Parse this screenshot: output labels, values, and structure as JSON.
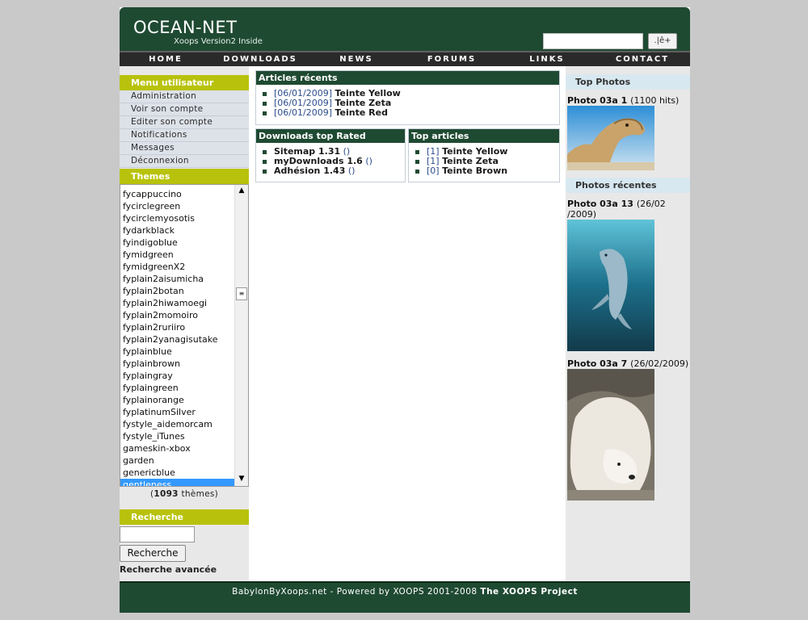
{
  "header": {
    "logo_title": "OCEAN-NET",
    "logo_subtitle": "Xoops Version2 Inside",
    "search_button_label": ".|ê+"
  },
  "nav": [
    "HOME",
    "DOWNLOADS",
    "NEWS",
    "FORUMS",
    "LINKS",
    "CONTACT"
  ],
  "user_menu": {
    "title": "Menu utilisateur",
    "items": [
      "Administration",
      "Voir son compte",
      "Editer son compte",
      "Notifications",
      "Messages",
      "Déconnexion"
    ]
  },
  "themes": {
    "title": "Themes",
    "items": [
      "fycappuccino",
      "fycirclegreen",
      "fycirclemyosotis",
      "fydarkblack",
      "fyindigoblue",
      "fymidgreen",
      "fymidgreenX2",
      "fyplain2aisumicha",
      "fyplain2botan",
      "fyplain2hiwamoegi",
      "fyplain2momoiro",
      "fyplain2ruriiro",
      "fyplain2yanagisutake",
      "fyplainblue",
      "fyplainbrown",
      "fyplaingray",
      "fyplaingreen",
      "fyplainorange",
      "fyplatinumSilver",
      "fystyle_aidemorcam",
      "fystyle_iTunes",
      "gameskin-xbox",
      "garden",
      "genericblue",
      "gentleness"
    ],
    "selected": "gentleness",
    "count": "1093",
    "count_suffix": "thèmes"
  },
  "search_block": {
    "title": "Recherche",
    "button": "Recherche",
    "advanced": "Recherche avancée"
  },
  "recent_articles": {
    "title": "Articles récents",
    "items": [
      {
        "date": "[06/01/2009]",
        "name": "Teinte Yellow"
      },
      {
        "date": "[06/01/2009]",
        "name": "Teinte Zeta"
      },
      {
        "date": "[06/01/2009]",
        "name": "Teinte Red"
      }
    ]
  },
  "downloads_top": {
    "title": "Downloads top Rated",
    "items": [
      {
        "name": "Sitemap 1.31",
        "extra": "()"
      },
      {
        "name": "myDownloads 1.6",
        "extra": "()"
      },
      {
        "name": "Adhésion 1.43",
        "extra": "()"
      }
    ]
  },
  "top_articles": {
    "title": "Top articles",
    "items": [
      {
        "rank": "[1]",
        "name": "Teinte Yellow"
      },
      {
        "rank": "[1]",
        "name": "Teinte Zeta"
      },
      {
        "rank": "[0]",
        "name": "Teinte Brown"
      }
    ]
  },
  "top_photos": {
    "title": "Top Photos",
    "caption": "Photo 03a 1",
    "hits": "(1100 hits)",
    "image": "camel"
  },
  "recent_photos": {
    "title": "Photos récentes",
    "items": [
      {
        "caption": "Photo 03a 13",
        "date": "(26/02",
        "date2": "/2009)",
        "image": "dolphin"
      },
      {
        "caption": "Photo 03a 7",
        "date": "(26/02/2009)",
        "image": "polar-bear"
      }
    ]
  },
  "footer": {
    "text": "BabylonByXoops.net - Powered by XOOPS 2001-2008",
    "link": "The XOOPS Project"
  },
  "colors": {
    "header": "#1f4a32",
    "block_title": "#b8c20c",
    "right_title": "#d8e8f0",
    "selected": "#3399ff"
  }
}
